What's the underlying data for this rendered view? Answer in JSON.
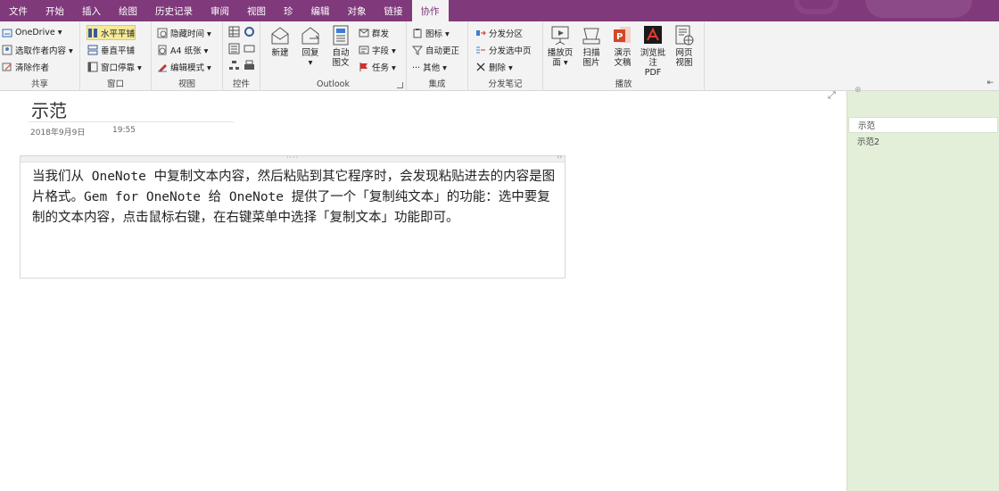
{
  "menu": {
    "tabs": [
      "文件",
      "开始",
      "插入",
      "绘图",
      "历史记录",
      "审阅",
      "视图",
      "珍",
      "编辑",
      "对象",
      "链接",
      "协作"
    ],
    "active_index": 11
  },
  "ribbon": {
    "share": {
      "label": "共享",
      "onedrive": "OneDrive ▾",
      "pick_author": "选取作者内容 ▾",
      "clear_author": "清除作者"
    },
    "window": {
      "label": "窗口",
      "horizontal": "水平平铺",
      "vertical": "垂直平铺",
      "dock": "窗口停靠 ▾"
    },
    "view": {
      "label": "视图",
      "hide_time": "隐藏时间 ▾",
      "paper": "A4 纸张 ▾",
      "edit_mode": "编辑模式 ▾"
    },
    "controls": {
      "label": "控件"
    },
    "outlook": {
      "label": "Outlook",
      "new": "新建",
      "reply": "回复",
      "auto_line1": "自动",
      "auto_line2": "图文",
      "mass": "群发",
      "field": "字段 ▾",
      "task": "任务 ▾"
    },
    "integrate": {
      "label": "集成",
      "icon": "图标 ▾",
      "auto_correct": "自动更正",
      "other": "··· 其他 ▾"
    },
    "distribute": {
      "label": "分发笔记",
      "section": "分发分区",
      "selected_page": "分发选中页",
      "delete": "删除 ▾"
    },
    "play": {
      "label": "播放",
      "play_page_1": "播放页",
      "play_page_2": "面 ▾",
      "scan_1": "扫描",
      "scan_2": "图片",
      "demo_1": "演示",
      "demo_2": "文稿",
      "pdf_1": "浏览批",
      "pdf_2": "注 PDF",
      "web_1": "网页",
      "web_2": "视图"
    }
  },
  "page": {
    "title": "示范",
    "date": "2018年9月9日",
    "time": "19:55",
    "note_dots": "····",
    "note_arrows": "‹›",
    "note_text": "当我们从 OneNote 中复制文本内容，然后粘贴到其它程序时，会发现粘贴进去的内容是图片格式。Gem for OneNote 给 OneNote 提供了一个「复制纯文本」的功能：选中要复制的文本内容，点击鼠标右键，在右键菜单中选择「复制文本」功能即可。"
  },
  "right_pane": {
    "pages": [
      "示范",
      "示范2"
    ],
    "selected_index": 0
  },
  "colors": {
    "accent": "#80397b",
    "ribbon_bg": "#f3f3f3",
    "pane_bg": "#e3efd9",
    "highlight": "#f5e99a"
  }
}
